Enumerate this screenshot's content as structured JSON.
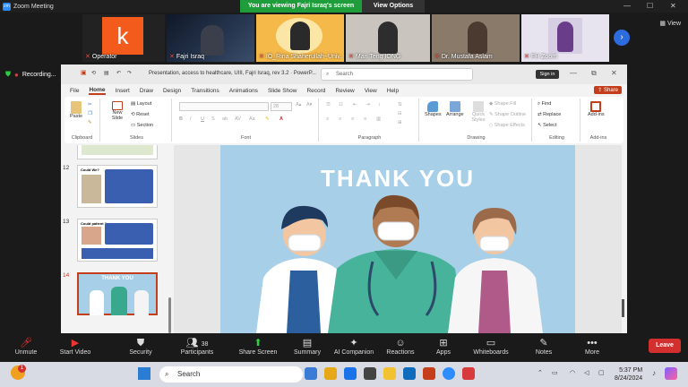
{
  "window": {
    "title": "Zoom Meeting"
  },
  "share_banner": "You are viewing Fajri Israq's screen",
  "view_options": "View Options",
  "gallery": {
    "view_label": "View",
    "participants": [
      {
        "name": "Operator",
        "avatar_letter": "k"
      },
      {
        "name": "Fajri Israq"
      },
      {
        "name": "IO_Rina Shaherullah~Univ."
      },
      {
        "name": "Man Teng IONG"
      },
      {
        "name": "Dr. Mustafa Aslam"
      },
      {
        "name": "FH Zoom"
      }
    ]
  },
  "recording": "Recording...",
  "ppt": {
    "doc_title": "Presentation, access to healthcare, UIII, Fajri Israq, rev 3.2  ·  PowerP...",
    "search_placeholder": "Search",
    "sign_in": "Sign in",
    "share": "Share",
    "menu": [
      "File",
      "Home",
      "Insert",
      "Draw",
      "Design",
      "Transitions",
      "Animations",
      "Slide Show",
      "Record",
      "Review",
      "View",
      "Help"
    ],
    "ribbon": {
      "clipboard": {
        "label": "Clipboard",
        "paste": "Paste"
      },
      "slides": {
        "label": "Slides",
        "new_slide": "New Slide",
        "layout": "Layout",
        "reset": "Reset",
        "section": "Section"
      },
      "font": {
        "label": "Font",
        "size": "28"
      },
      "paragraph": {
        "label": "Paragraph"
      },
      "drawing": {
        "label": "Drawing",
        "shapes": "Shapes",
        "arrange": "Arrange",
        "quick_styles": "Quick Styles",
        "shape_fill": "Shape Fill",
        "shape_outline": "Shape Outline",
        "shape_effects": "Shape Effects"
      },
      "editing": {
        "label": "Editing",
        "find": "Find",
        "replace": "Replace",
        "select": "Select"
      },
      "addins": {
        "label": "Add-ins",
        "addins": "Add-ins"
      }
    },
    "thumbnails": [
      {
        "num": "12",
        "title": "Could We?"
      },
      {
        "num": "13",
        "title": "Could patient ?"
      },
      {
        "num": "14",
        "title": "THANK YOU"
      }
    ],
    "slide": {
      "headline": "THANK YOU"
    }
  },
  "toolbar": {
    "unmute": "Unmute",
    "start_video": "Start Video",
    "security": "Security",
    "participants": "Participants",
    "participants_count": "38",
    "share_screen": "Share Screen",
    "summary": "Summary",
    "ai_companion": "AI Companion",
    "reactions": "Reactions",
    "apps": "Apps",
    "whiteboards": "Whiteboards",
    "notes": "Notes",
    "more": "More",
    "leave": "Leave"
  },
  "taskbar": {
    "search_placeholder": "Search",
    "time": "5:37 PM",
    "date": "8/24/2024",
    "notification_count": "1"
  },
  "colors": {
    "share_green": "#1f9d3a",
    "ppt_accent": "#c43e1c",
    "leave_red": "#d32f2f",
    "slide_bg": "#a8cfe8"
  }
}
